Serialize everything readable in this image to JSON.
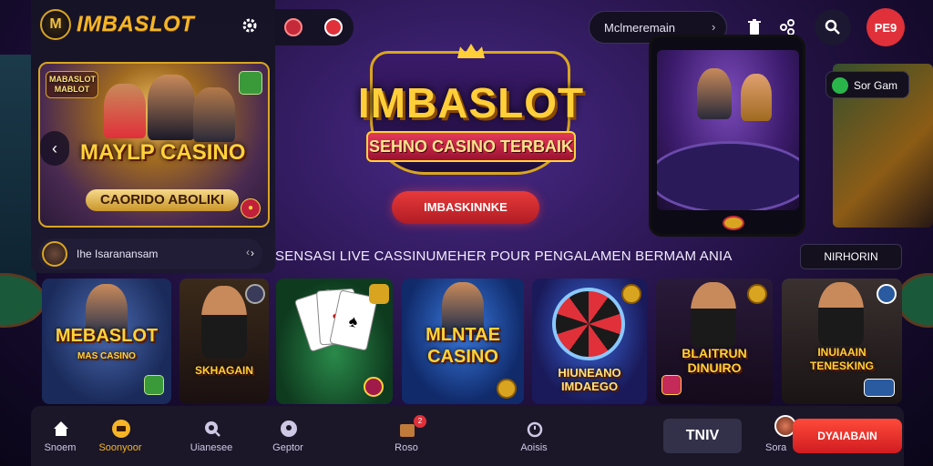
{
  "header": {
    "logo_badge": "M",
    "logo_text": "IMBASLOT",
    "search_pill_text": "Mclmeremain",
    "profile_label": "PE9"
  },
  "hero_card": {
    "mini_logo": "MABASLOT MABLOT",
    "title": "MAYLP CASINO",
    "subtitle": "CAORIDO ABOLIKI"
  },
  "provider": {
    "name": "Ihe Isaranansam"
  },
  "main_banner": {
    "logo_text": "IMBASLOT",
    "ribbon_text": "SEHNO CASINO TERBAIK",
    "cta_label": "IMBASKINNKE"
  },
  "side_pill": {
    "label": "Sor Gam"
  },
  "tagline": "SENSASI LIVE CASSINUMEHER POUR PENGALAMEN BERMAM ANIA",
  "tag_pill": "NIRHORIN",
  "game_cards": [
    {
      "title": "MEBASLOT",
      "sub": "MAS CASINO"
    },
    {
      "title": "SKHAGAIN",
      "sub": ""
    },
    {
      "title": "",
      "sub": ""
    },
    {
      "title": "MLNTAE CASINO",
      "sub": ""
    },
    {
      "title": "HIUNEANO IMDAEGO",
      "sub": ""
    },
    {
      "title": "BLAITRUN DINUIRO",
      "sub": ""
    },
    {
      "title": "INUIAAIN TENESKING",
      "sub": ""
    }
  ],
  "bottom_nav": [
    {
      "label": "Snoem",
      "icon": "home-icon"
    },
    {
      "label": "Soonyoor",
      "icon": "slot-icon"
    },
    {
      "label": "Uianesee",
      "icon": "search-icon"
    },
    {
      "label": "Geptor",
      "icon": "location-icon"
    },
    {
      "label": "Roso",
      "icon": "gift-icon",
      "badge": "2"
    },
    {
      "label": "Aoisis",
      "icon": "alarm-icon"
    }
  ],
  "tv_button": "TNIV",
  "mini_label": "Sora",
  "cta_bottom": "DYAIABAIN",
  "colors": {
    "accent_gold": "#f5b526",
    "cta_red": "#e0303a",
    "panel_dark": "#171326"
  }
}
